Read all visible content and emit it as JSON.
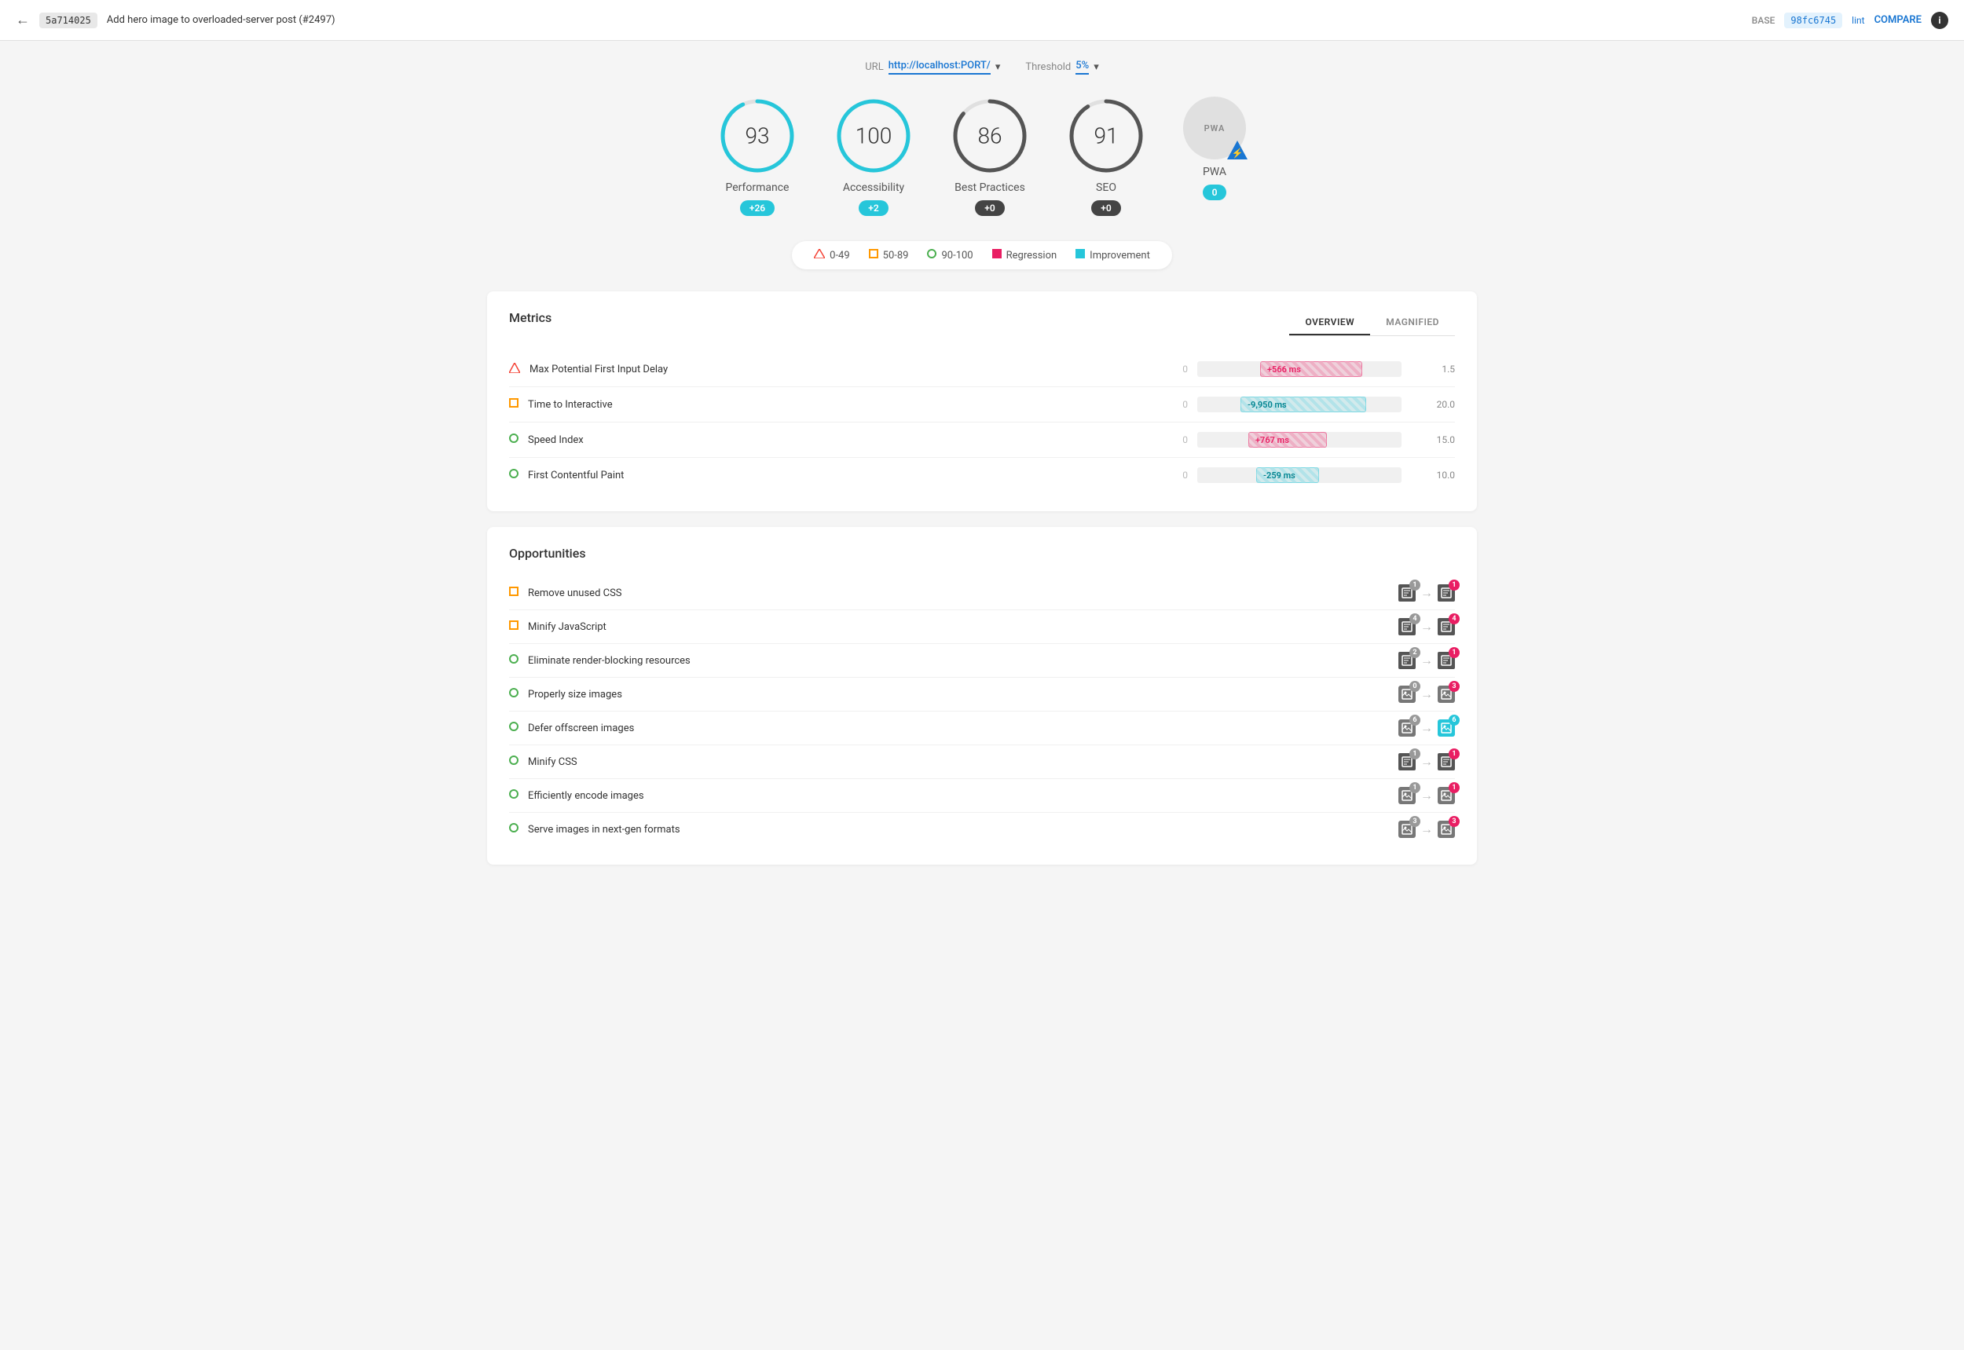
{
  "header": {
    "back_icon": "←",
    "commit_base": "5a714025",
    "commit_title": "Add hero image to overloaded-server post (#2497)",
    "base_label": "BASE",
    "commit_lint": "98fc6745",
    "lint_label": "lint",
    "compare_label": "COMPARE",
    "info_label": "i"
  },
  "controls": {
    "url_label": "URL",
    "url_value": "http://localhost:PORT/",
    "threshold_label": "Threshold",
    "threshold_value": "5%"
  },
  "scores": [
    {
      "id": "performance",
      "value": "93",
      "label": "Performance",
      "badge": "+26",
      "badge_type": "teal",
      "color": "#26c6da",
      "bg_color": "#e0f7fa",
      "stroke": "#26c6da",
      "track": "#e0e0e0",
      "pct": 93
    },
    {
      "id": "accessibility",
      "value": "100",
      "label": "Accessibility",
      "badge": "+2",
      "badge_type": "teal",
      "color": "#26c6da",
      "stroke": "#26c6da",
      "track": "#e0e0e0",
      "pct": 100
    },
    {
      "id": "best-practices",
      "value": "86",
      "label": "Best Practices",
      "badge": "+0",
      "badge_type": "dark",
      "stroke": "#333",
      "track": "#e0e0e0",
      "pct": 86
    },
    {
      "id": "seo",
      "value": "91",
      "label": "SEO",
      "badge": "+0",
      "badge_type": "dark",
      "stroke": "#333",
      "track": "#e0e0e0",
      "pct": 91
    },
    {
      "id": "pwa",
      "value": "PWA",
      "label": "PWA",
      "badge": "0",
      "badge_type": "pwa"
    }
  ],
  "legend": {
    "items": [
      {
        "id": "0-49",
        "type": "triangle",
        "label": "0-49"
      },
      {
        "id": "50-89",
        "type": "square-orange",
        "label": "50-89"
      },
      {
        "id": "90-100",
        "type": "circle-green",
        "label": "90-100"
      },
      {
        "id": "regression",
        "type": "square-red",
        "label": "Regression"
      },
      {
        "id": "improvement",
        "type": "square-teal",
        "label": "Improvement"
      }
    ]
  },
  "metrics": {
    "title": "Metrics",
    "tabs": [
      {
        "id": "overview",
        "label": "OVERVIEW",
        "active": true
      },
      {
        "id": "magnified",
        "label": "MAGNIFIED",
        "active": false
      }
    ],
    "rows": [
      {
        "id": "first-input-delay",
        "indicator": "triangle",
        "name": "Max Potential First Input Delay",
        "zero": "0",
        "bar_type": "regression",
        "bar_label": "+566 ms",
        "bar_width_pct": 55,
        "bar_offset_pct": 35,
        "score": "1.5"
      },
      {
        "id": "time-to-interactive",
        "indicator": "square-orange",
        "name": "Time to Interactive",
        "zero": "0",
        "bar_type": "improvement",
        "bar_label": "-9,950 ms",
        "bar_width_pct": 60,
        "bar_offset_pct": 20,
        "score": "20.0"
      },
      {
        "id": "speed-index",
        "indicator": "circle-green",
        "name": "Speed Index",
        "zero": "0",
        "bar_type": "regression",
        "bar_label": "+767 ms",
        "bar_width_pct": 35,
        "bar_offset_pct": 28,
        "score": "15.0"
      },
      {
        "id": "first-contentful-paint",
        "indicator": "circle-green",
        "name": "First Contentful Paint",
        "zero": "0",
        "bar_type": "improvement",
        "bar_label": "-259 ms",
        "bar_width_pct": 22,
        "bar_offset_pct": 30,
        "score": "10.0"
      }
    ]
  },
  "opportunities": {
    "title": "Opportunities",
    "rows": [
      {
        "id": "remove-unused-css",
        "indicator": "square-orange",
        "name": "Remove unused CSS",
        "icon_type": "file",
        "badge_from": "1",
        "badge_from_color": "gray",
        "badge_to": "1",
        "badge_to_color": "red"
      },
      {
        "id": "minify-javascript",
        "indicator": "square-orange",
        "name": "Minify JavaScript",
        "icon_type": "file",
        "badge_from": "4",
        "badge_from_color": "gray",
        "badge_to": "4",
        "badge_to_color": "red"
      },
      {
        "id": "eliminate-render-blocking",
        "indicator": "circle-green",
        "name": "Eliminate render-blocking resources",
        "icon_type": "file",
        "badge_from": "2",
        "badge_from_color": "gray",
        "badge_to": "1",
        "badge_to_color": "red"
      },
      {
        "id": "properly-size-images",
        "indicator": "circle-green",
        "name": "Properly size images",
        "icon_type": "image",
        "badge_from": "0",
        "badge_from_color": "gray",
        "badge_to": "3",
        "badge_to_color": "red"
      },
      {
        "id": "defer-offscreen-images",
        "indicator": "circle-green",
        "name": "Defer offscreen images",
        "icon_type": "image",
        "badge_from": "6",
        "badge_from_color": "gray",
        "badge_to": "6",
        "badge_to_color": "teal"
      },
      {
        "id": "minify-css",
        "indicator": "circle-green",
        "name": "Minify CSS",
        "icon_type": "file",
        "badge_from": "1",
        "badge_from_color": "gray",
        "badge_to": "1",
        "badge_to_color": "red"
      },
      {
        "id": "efficiently-encode-images",
        "indicator": "circle-green",
        "name": "Efficiently encode images",
        "icon_type": "image",
        "badge_from": "1",
        "badge_from_color": "gray",
        "badge_to": "1",
        "badge_to_color": "red"
      },
      {
        "id": "serve-next-gen-formats",
        "indicator": "circle-green",
        "name": "Serve images in next-gen formats",
        "icon_type": "image",
        "badge_from": "3",
        "badge_from_color": "gray",
        "badge_to": "3",
        "badge_to_color": "red"
      }
    ]
  }
}
